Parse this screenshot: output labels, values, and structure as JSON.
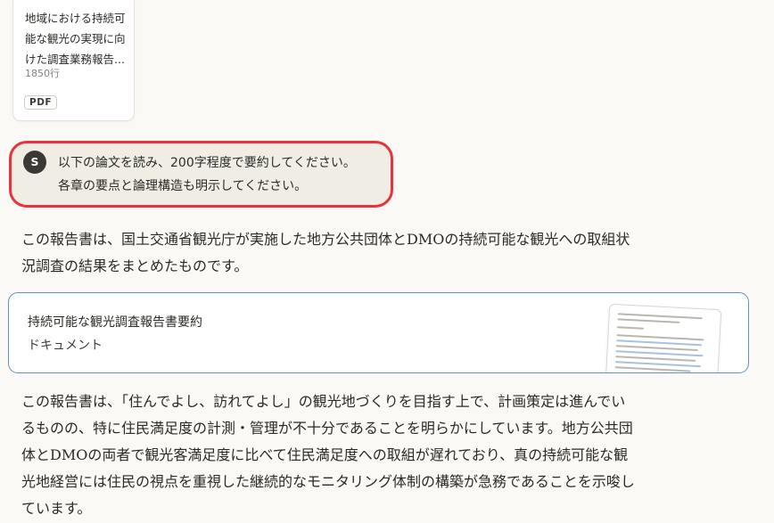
{
  "attachment": {
    "title": "地域における持続可能な観光の実現に向けた調査業務報告...",
    "lines": "1850行",
    "type_badge": "PDF"
  },
  "user_message": {
    "avatar_initial": "S",
    "lines": [
      "以下の論文を読み、200字程度で要約してください。",
      "各章の要点と論理構造も明示してください。"
    ]
  },
  "reply": {
    "intro_lines": [
      "この報告書は、国土交通省観光庁が実施した地方公共団体とDMOの持続可能な観光への取組状",
      "況調査の結果をまとめたものです。"
    ],
    "artifact": {
      "title": "持続可能な観光調査報告書要約",
      "type": "ドキュメント"
    },
    "summary_lines": [
      "この報告書は、「住んでよし、訪れてよし」の観光地づくりを目指す上で、計画策定は進んでい",
      "るものの、特に住民満足度の計測・管理が不十分であることを明らかにしています。地方公共団",
      "体とDMOの両者で観光客満足度に比べて住民満足度への取組が遅れており、真の持続可能な観",
      "光地経営には住民の視点を重視した継続的なモニタリング体制の構築が急務であることを示唆し",
      "ています。"
    ]
  },
  "colors": {
    "highlight_border": "#e8323c",
    "artifact_border": "#5b93c9",
    "bubble_bg": "#efede4",
    "page_bg": "#faf9f5"
  }
}
